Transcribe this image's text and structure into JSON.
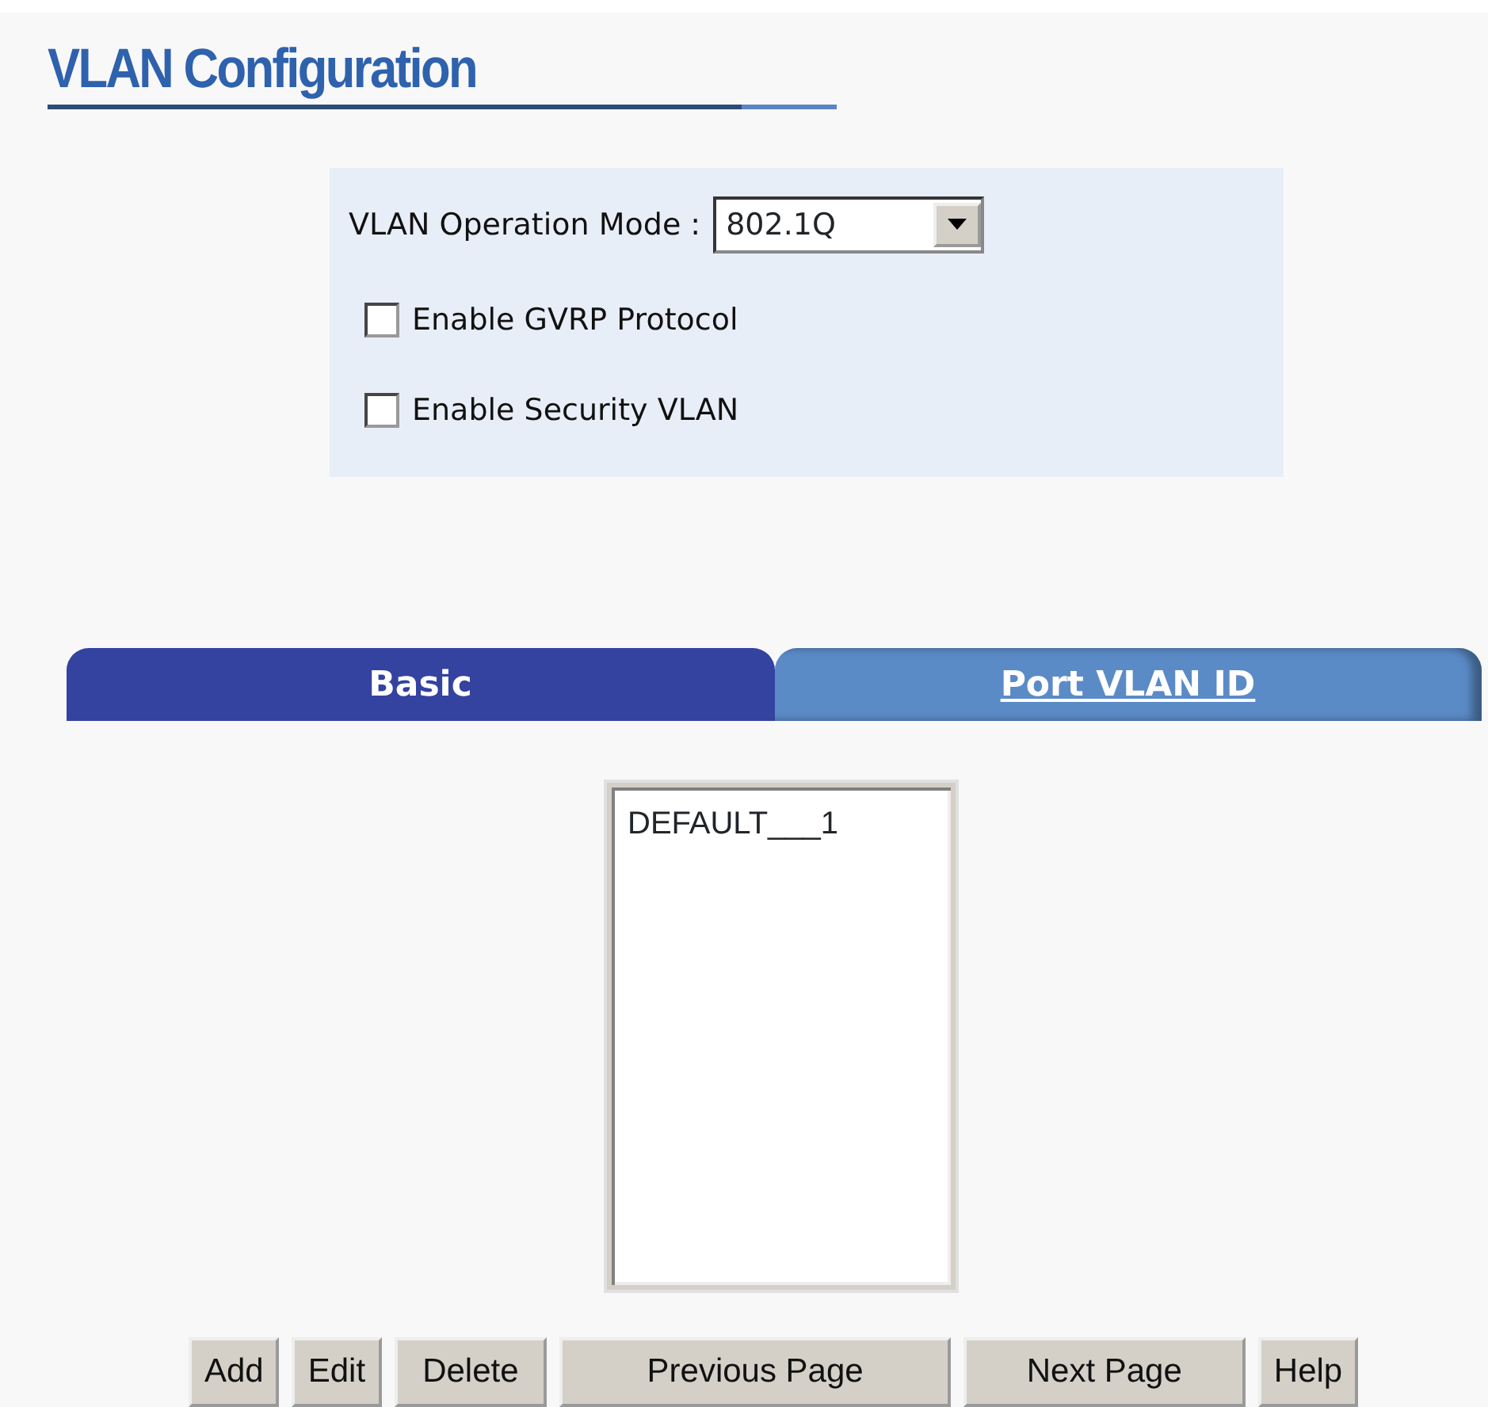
{
  "title": "VLAN Configuration",
  "settings": {
    "mode_label": "VLAN Operation Mode :",
    "mode_value": "802.1Q",
    "options": [
      {
        "label": "Enable GVRP Protocol",
        "checked": false
      },
      {
        "label": "Enable Security VLAN",
        "checked": false
      }
    ]
  },
  "tabs": [
    {
      "label": "Basic",
      "selected": true
    },
    {
      "label": "Port VLAN ID",
      "selected": false
    }
  ],
  "vlan_list": [
    {
      "label": "DEFAULT___1",
      "selected": false
    }
  ],
  "buttons": [
    "Add",
    "Edit",
    "Delete",
    "Previous Page",
    "Next Page",
    "Help"
  ]
}
